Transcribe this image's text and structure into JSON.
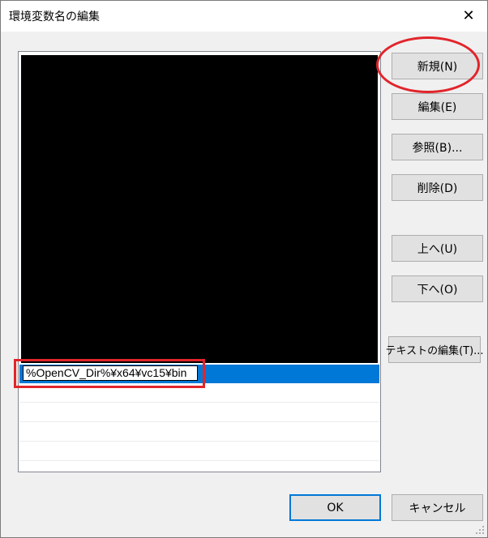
{
  "window": {
    "title": "環境変数名の編集",
    "close_glyph": "✕"
  },
  "list": {
    "selected_value": "%OpenCV_Dir%¥x64¥vc15¥bin"
  },
  "buttons": {
    "new": "新規(N)",
    "edit": "編集(E)",
    "browse": "参照(B)...",
    "delete": "削除(D)",
    "up": "上へ(U)",
    "down": "下へ(O)",
    "edit_text": "テキストの編集(T)...",
    "ok": "OK",
    "cancel": "キャンセル"
  },
  "colors": {
    "selection": "#0078d7",
    "annotation": "#e1252b"
  }
}
